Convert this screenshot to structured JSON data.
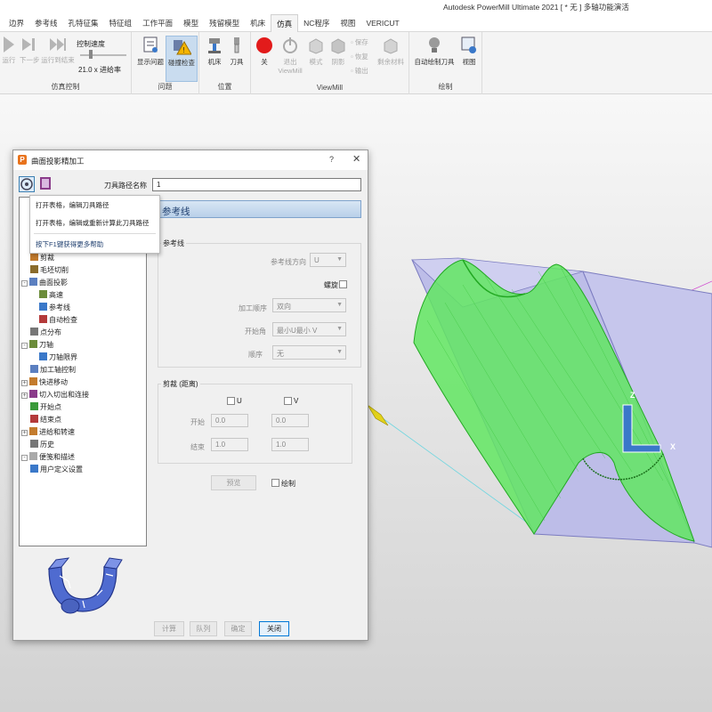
{
  "app": {
    "title": "Autodesk PowerMill Ultimate 2021    [ * 无 ]    多轴功能演活"
  },
  "tabs": [
    {
      "label": "边界"
    },
    {
      "label": "参考线"
    },
    {
      "label": "孔特征集"
    },
    {
      "label": "特征组"
    },
    {
      "label": "工作平面"
    },
    {
      "label": "模型"
    },
    {
      "label": "残留模型"
    },
    {
      "label": "机床"
    },
    {
      "label": "仿真",
      "active": true
    },
    {
      "label": "NC程序"
    },
    {
      "label": "视图"
    },
    {
      "label": "VERICUT"
    }
  ],
  "ribbon": {
    "sim_control": {
      "label": "仿真控制",
      "run": "运行",
      "next": "下一步",
      "run_to_end": "运行到结束",
      "speed_label": "控制速度",
      "speed_value": "21.0 x 进给率"
    },
    "problem": {
      "label": "问题",
      "show": "显示问题",
      "collision": "碰撞检查"
    },
    "position": {
      "label": "位置",
      "machine": "机床",
      "tool": "刀具"
    },
    "viewmill": {
      "label": "ViewMill",
      "off": "关",
      "exit": "退出",
      "exit2": "ViewMill",
      "mode": "模式",
      "shade": "阴影",
      "save": "保存",
      "restore": "恢复",
      "export": "输出",
      "residual": "剩余材料"
    },
    "draw": {
      "label": "绘制",
      "auto_draw": "自动绘制刀具",
      "view": "视图"
    }
  },
  "dialog": {
    "title": "曲面投影精加工",
    "help": "?",
    "close": "✕",
    "path_name_label": "刀具路径名称",
    "path_name_value": "1",
    "section_title": "参考线",
    "tooltip": {
      "line1": "打开表格，编辑刀具路径",
      "line2": "打开表格，编辑或重新计算此刀具路径",
      "line3": "按下F1键获得更多帮助"
    },
    "tree": [
      {
        "label": "剪裁",
        "indent": 1,
        "expander": ""
      },
      {
        "label": "毛坯切削",
        "indent": 1,
        "expander": ""
      },
      {
        "label": "曲面投影",
        "indent": 0,
        "expander": "-"
      },
      {
        "label": "高速",
        "indent": 2,
        "expander": ""
      },
      {
        "label": "参考线",
        "indent": 2,
        "expander": ""
      },
      {
        "label": "自动检查",
        "indent": 2,
        "expander": ""
      },
      {
        "label": "点分布",
        "indent": 1,
        "expander": ""
      },
      {
        "label": "刀轴",
        "indent": 0,
        "expander": "-"
      },
      {
        "label": "刀轴限界",
        "indent": 2,
        "expander": ""
      },
      {
        "label": "加工轴控制",
        "indent": 1,
        "expander": ""
      },
      {
        "label": "快进移动",
        "indent": 0,
        "expander": "+"
      },
      {
        "label": "切入切出和连接",
        "indent": 0,
        "expander": "+"
      },
      {
        "label": "开始点",
        "indent": 1,
        "expander": ""
      },
      {
        "label": "结束点",
        "indent": 1,
        "expander": ""
      },
      {
        "label": "进给和转速",
        "indent": 0,
        "expander": "+"
      },
      {
        "label": "历史",
        "indent": 1,
        "expander": ""
      },
      {
        "label": "便笺和描述",
        "indent": 0,
        "expander": "-"
      },
      {
        "label": "用户定义设置",
        "indent": 1,
        "expander": ""
      }
    ],
    "refline": {
      "group_title": "参考线",
      "direction_label": "参考线方向",
      "direction_value": "U",
      "spiral_label": "螺旋",
      "order_label": "加工顺序",
      "order_value": "双向",
      "start_label": "开始角",
      "start_value": "最小U最小 V",
      "sequence_label": "顺序",
      "sequence_value": "无"
    },
    "trim": {
      "group_title": "剪裁 (距离)",
      "u_label": "U",
      "v_label": "V",
      "start_label": "开始",
      "end_label": "结束",
      "u_start": "0.0",
      "v_start": "0.0",
      "u_end": "1.0",
      "v_end": "1.0"
    },
    "preview_btn": "预览",
    "draw_label": "绘制",
    "buttons": {
      "calculate": "计算",
      "queue": "队列",
      "ok": "确定",
      "close": "关闭"
    }
  },
  "viewport": {
    "axis_z": "Z",
    "axis_x": "X"
  },
  "colors": {
    "accent": "#0078d7",
    "toolpath": "#3fe03f",
    "block": "#b9b9e6",
    "stop": "#e21b1b"
  }
}
